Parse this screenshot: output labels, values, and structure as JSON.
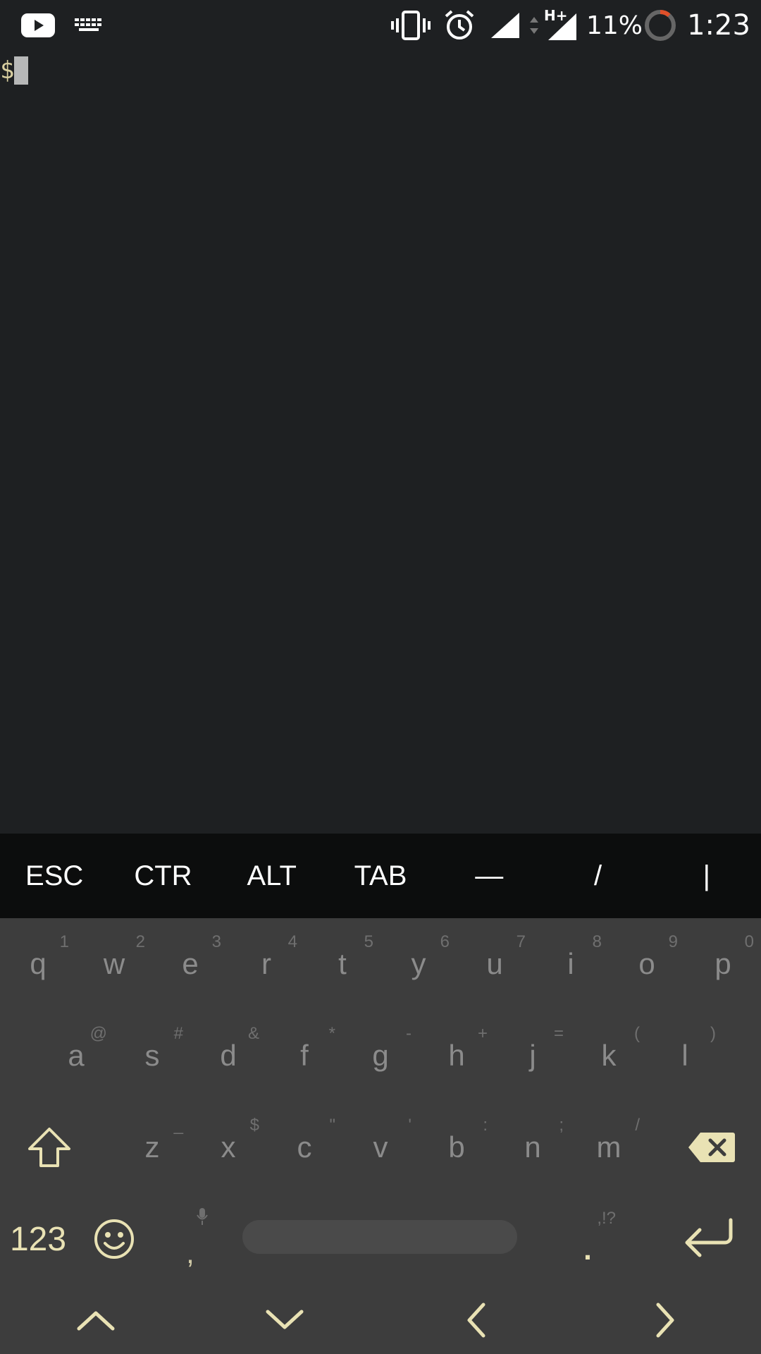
{
  "status_bar": {
    "icons": [
      "youtube-icon",
      "keyboard-icon",
      "vibrate-icon",
      "alarm-icon",
      "signal-icon",
      "data-arrows-icon",
      "signal-hplus-icon",
      "battery-ring-icon"
    ],
    "network_type": "H+",
    "battery": "11%",
    "time": "1:23",
    "accent_color": "#e0502a"
  },
  "terminal": {
    "prompt": "$"
  },
  "extra_keys": [
    "ESC",
    "CTR",
    "ALT",
    "TAB",
    "—",
    "/",
    "|"
  ],
  "keyboard": {
    "row1": [
      {
        "key": "q",
        "hint": "1"
      },
      {
        "key": "w",
        "hint": "2"
      },
      {
        "key": "e",
        "hint": "3"
      },
      {
        "key": "r",
        "hint": "4"
      },
      {
        "key": "t",
        "hint": "5"
      },
      {
        "key": "y",
        "hint": "6"
      },
      {
        "key": "u",
        "hint": "7"
      },
      {
        "key": "i",
        "hint": "8"
      },
      {
        "key": "o",
        "hint": "9"
      },
      {
        "key": "p",
        "hint": "0"
      }
    ],
    "row2": [
      {
        "key": "a",
        "hint": "@"
      },
      {
        "key": "s",
        "hint": "#"
      },
      {
        "key": "d",
        "hint": "&"
      },
      {
        "key": "f",
        "hint": "*"
      },
      {
        "key": "g",
        "hint": "-"
      },
      {
        "key": "h",
        "hint": "+"
      },
      {
        "key": "j",
        "hint": "="
      },
      {
        "key": "k",
        "hint": "("
      },
      {
        "key": "l",
        "hint": ")"
      }
    ],
    "row3": [
      {
        "key": "z",
        "hint": "_"
      },
      {
        "key": "x",
        "hint": "$"
      },
      {
        "key": "c",
        "hint": "\""
      },
      {
        "key": "v",
        "hint": "'"
      },
      {
        "key": "b",
        "hint": ":"
      },
      {
        "key": "n",
        "hint": ";"
      },
      {
        "key": "m",
        "hint": "/"
      }
    ],
    "row4": {
      "symbols_label": "123",
      "comma": ",",
      "period": ".",
      "period_hint": ",!?"
    },
    "icon_color": "#e9e2b4"
  }
}
